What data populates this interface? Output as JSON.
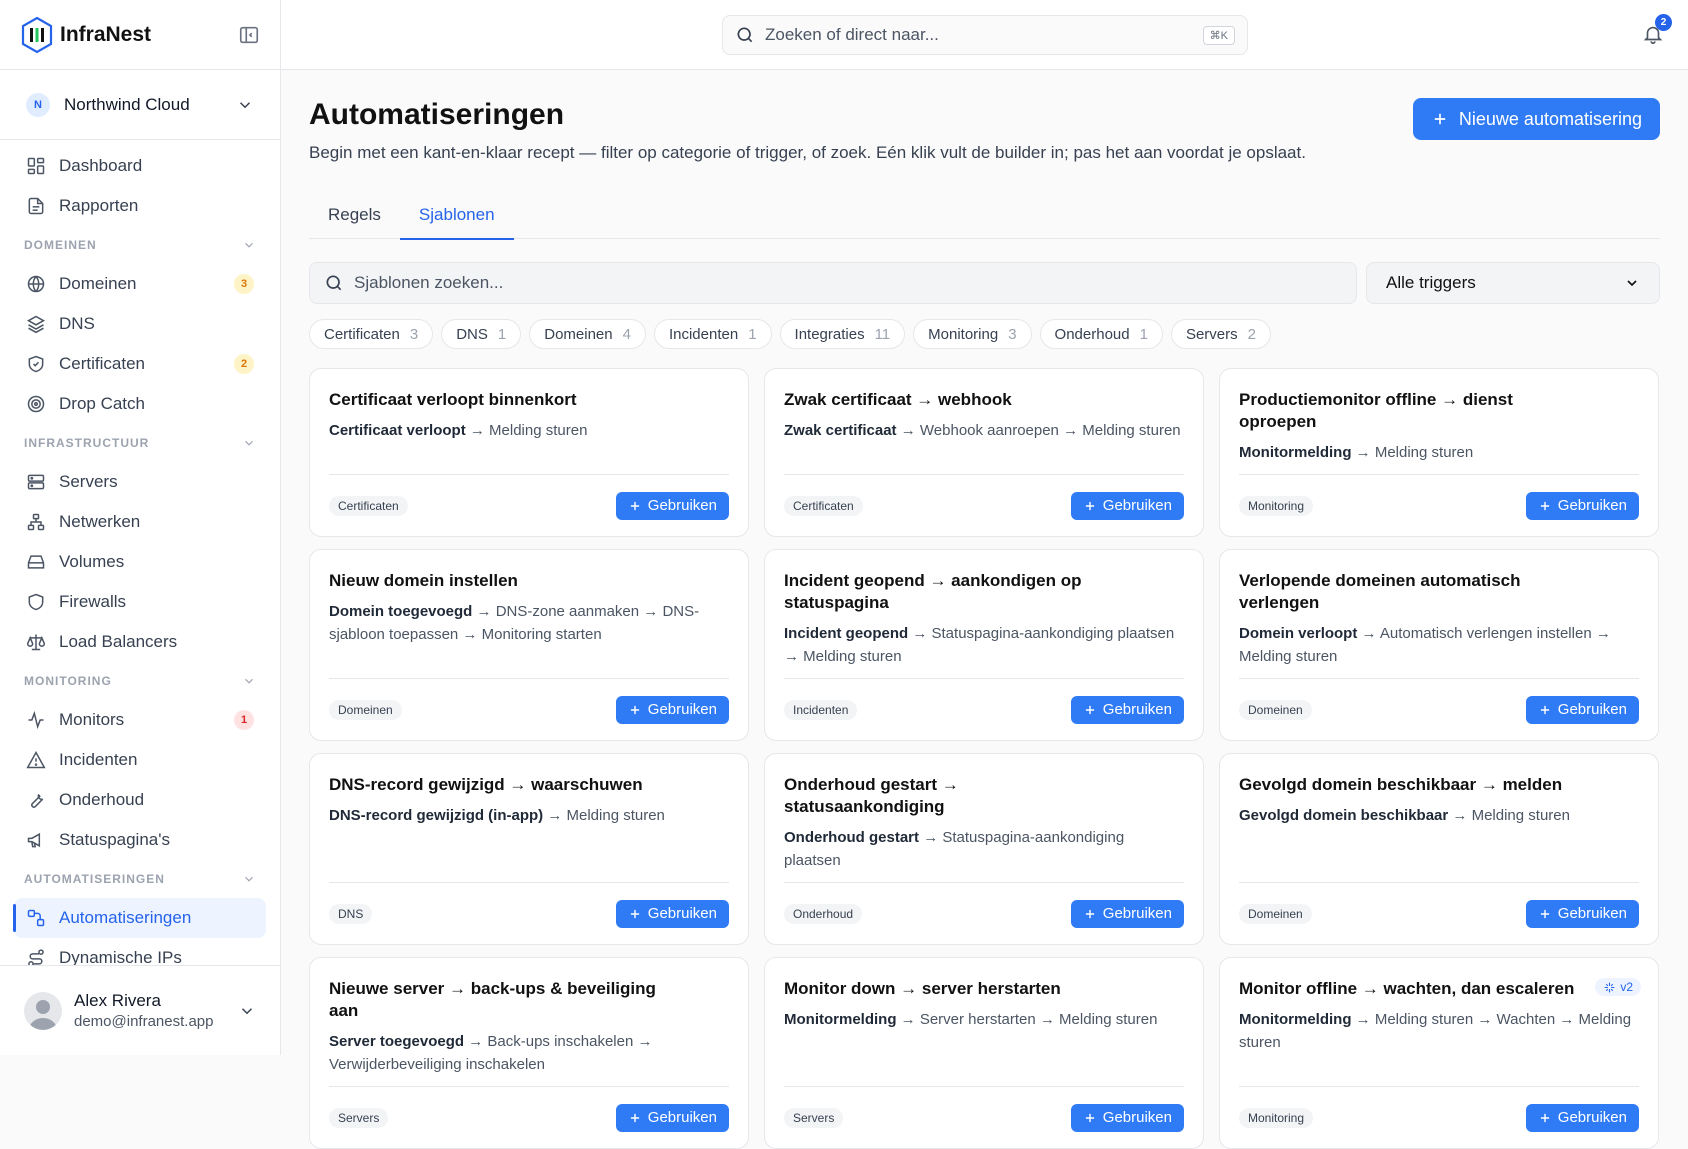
{
  "brand": {
    "name": "InfraNest"
  },
  "org": {
    "badge": "N",
    "name": "Northwind Cloud"
  },
  "search": {
    "placeholder": "Zoeken of direct naar...",
    "shortcut": "⌘K"
  },
  "notifications": {
    "count": "2"
  },
  "nav": {
    "top": [
      {
        "label": "Dashboard"
      },
      {
        "label": "Rapporten"
      }
    ],
    "sections": {
      "domeinen": "DOMEINEN",
      "infrastructuur": "INFRASTRUCTUUR",
      "monitoring": "MONITORING",
      "automatiseringen": "AUTOMATISERINGEN"
    },
    "domeinen": [
      {
        "label": "Domeinen",
        "count": "3"
      },
      {
        "label": "DNS"
      },
      {
        "label": "Certificaten",
        "count": "2"
      },
      {
        "label": "Drop Catch"
      }
    ],
    "infrastructuur": [
      {
        "label": "Servers"
      },
      {
        "label": "Netwerken"
      },
      {
        "label": "Volumes"
      },
      {
        "label": "Firewalls"
      },
      {
        "label": "Load Balancers"
      }
    ],
    "monitoring": [
      {
        "label": "Monitors",
        "count": "1"
      },
      {
        "label": "Incidenten"
      },
      {
        "label": "Onderhoud"
      },
      {
        "label": "Statuspagina's"
      }
    ],
    "automatiseringen": [
      {
        "label": "Automatiseringen"
      },
      {
        "label": "Dynamische IPs"
      }
    ]
  },
  "user": {
    "name": "Alex Rivera",
    "email": "demo@infranest.app"
  },
  "page": {
    "title": "Automatiseringen",
    "subtitle": "Begin met een kant-en-klaar recept — filter op categorie of trigger, of zoek. Eén klik vult de builder in; pas het aan voordat je opslaat.",
    "new_button": "Nieuwe automatisering"
  },
  "tabs": [
    "Regels",
    "Sjablonen"
  ],
  "filter": {
    "placeholder": "Sjablonen zoeken...",
    "trigger_select": "Alle triggers"
  },
  "chips": [
    {
      "label": "Certificaten",
      "count": "3"
    },
    {
      "label": "DNS",
      "count": "1"
    },
    {
      "label": "Domeinen",
      "count": "4"
    },
    {
      "label": "Incidenten",
      "count": "1"
    },
    {
      "label": "Integraties",
      "count": "11"
    },
    {
      "label": "Monitoring",
      "count": "3"
    },
    {
      "label": "Onderhoud",
      "count": "1"
    },
    {
      "label": "Servers",
      "count": "2"
    }
  ],
  "use_label": "Gebruiken",
  "templates": [
    {
      "title": "Certificaat verloopt binnenkort",
      "trigger": "Certificaat verloopt",
      "steps": "→ Melding sturen",
      "tag": "Certificaten"
    },
    {
      "title": "Zwak certificaat → webhook",
      "trigger": "Zwak certificaat",
      "steps": "→ Webhook aanroepen → Melding sturen",
      "tag": "Certificaten"
    },
    {
      "title": "Productiemonitor offline → dienst oproepen",
      "trigger": "Monitormelding",
      "steps": "→ Melding sturen",
      "tag": "Monitoring"
    },
    {
      "title": "Nieuw domein instellen",
      "trigger": "Domein toegevoegd",
      "steps": "→ DNS-zone aanmaken → DNS-sjabloon toepassen → Monitoring starten",
      "tag": "Domeinen"
    },
    {
      "title": "Incident geopend → aankondigen op statuspagina",
      "trigger": "Incident geopend",
      "steps": "→ Statuspagina-aankondiging plaatsen → Melding sturen",
      "tag": "Incidenten"
    },
    {
      "title": "Verlopende domeinen automatisch verlengen",
      "trigger": "Domein verloopt",
      "steps": "→ Automatisch verlengen instellen → Melding sturen",
      "tag": "Domeinen"
    },
    {
      "title": "DNS-record gewijzigd → waarschuwen",
      "trigger": "DNS-record gewijzigd (in-app)",
      "steps": "→ Melding sturen",
      "tag": "DNS"
    },
    {
      "title": "Onderhoud gestart → statusaankondiging",
      "trigger": "Onderhoud gestart",
      "steps": "→ Statuspagina-aankondiging plaatsen",
      "tag": "Onderhoud"
    },
    {
      "title": "Gevolgd domein beschikbaar → melden",
      "trigger": "Gevolgd domein beschikbaar",
      "steps": "→ Melding sturen",
      "tag": "Domeinen"
    },
    {
      "title": "Nieuwe server → back-ups & beveiliging aan",
      "trigger": "Server toegevoegd",
      "steps": "→ Back-ups inschakelen → Verwijderbeveiliging inschakelen",
      "tag": "Servers"
    },
    {
      "title": "Monitor down → server herstarten",
      "trigger": "Monitormelding",
      "steps": "→ Server herstarten → Melding sturen",
      "tag": "Servers"
    },
    {
      "title": "Monitor offline → wachten, dan escaleren",
      "trigger": "Monitormelding",
      "steps": "→ Melding sturen → Wachten → Melding sturen",
      "tag": "Monitoring",
      "badge": "v2"
    }
  ],
  "colors": {
    "accent": "#2f7bf5",
    "accent_text": "#2563eb",
    "amber": "#d97706",
    "red": "#dc2626"
  }
}
